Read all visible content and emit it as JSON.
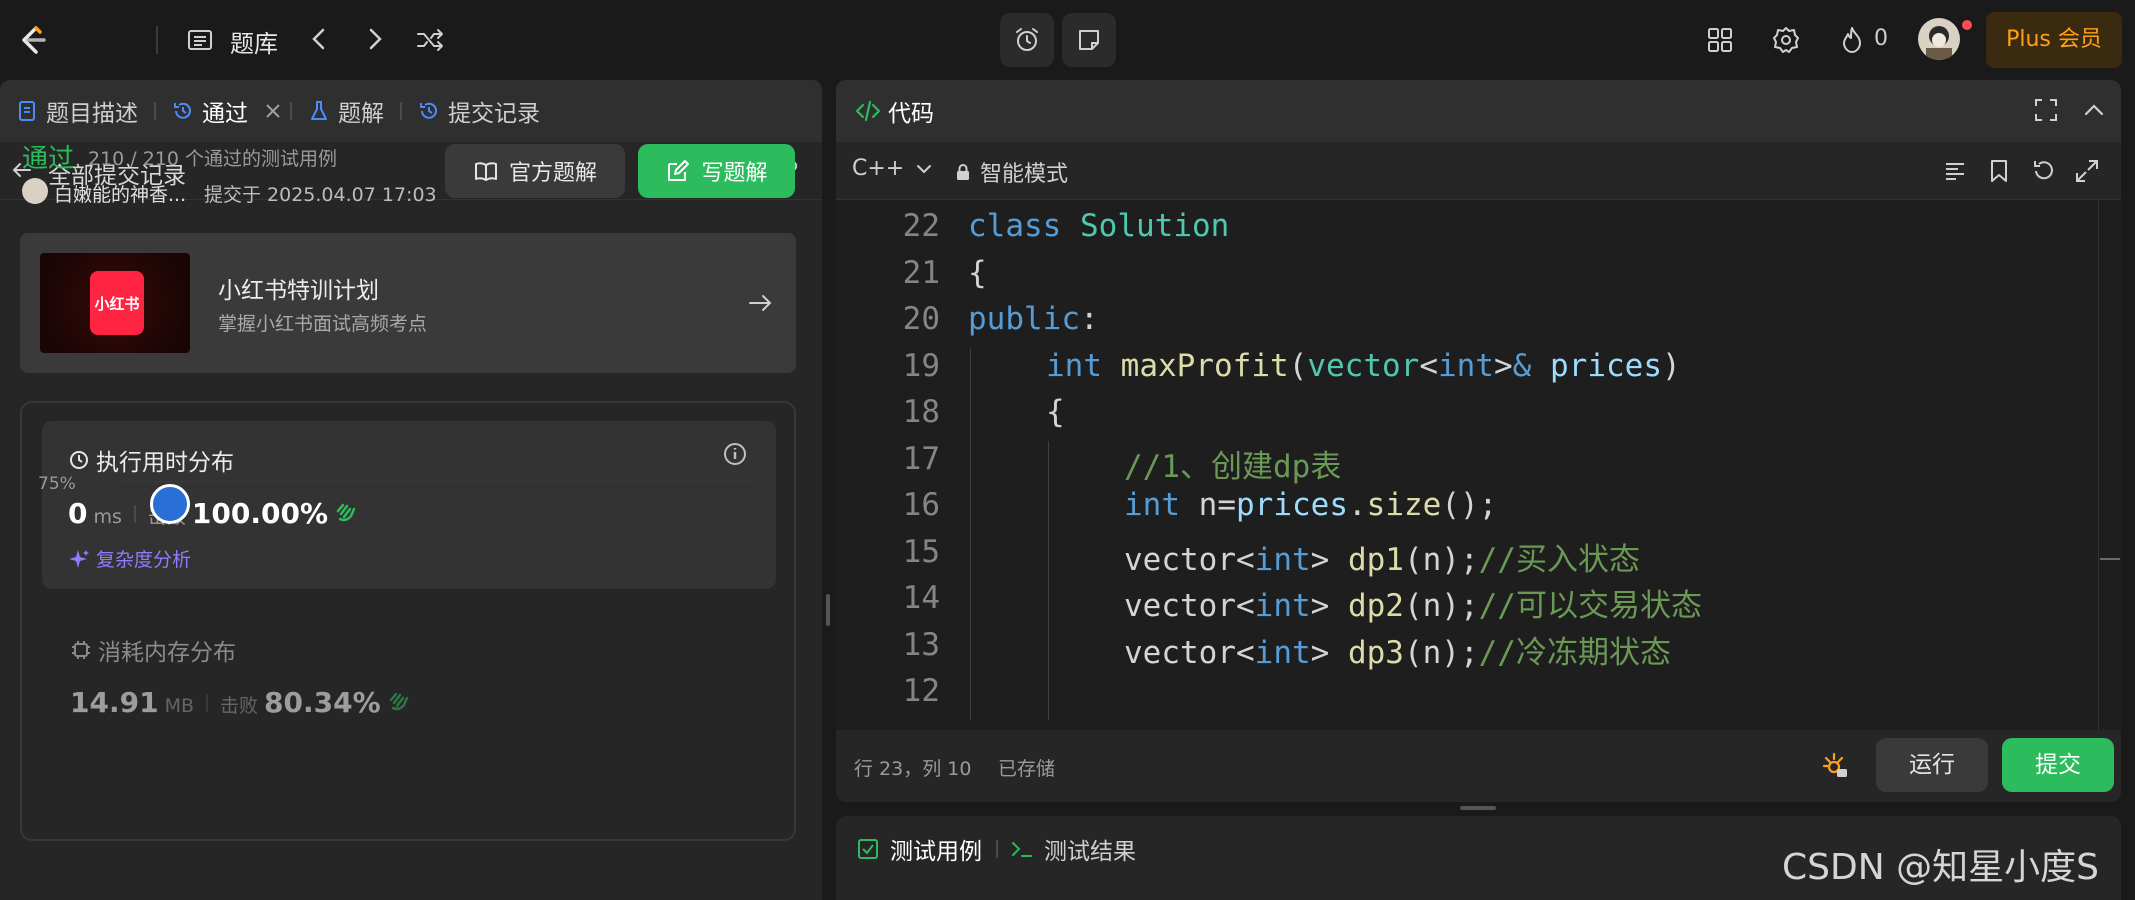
{
  "topbar": {
    "problem_bank": "题库",
    "streak": "0",
    "plus_label": "Plus 会员"
  },
  "left": {
    "tabs": [
      "题目描述",
      "通过",
      "题解",
      "提交记录"
    ],
    "sub_title": "全部提交记录",
    "status": "通过",
    "status_detail": "210 / 210 个通过的测试用例",
    "user_name": "白嫩能的神香...",
    "submit_time": "提交于 2025.04.07 17:03",
    "btn_official": "官方题解",
    "btn_write": "写题解",
    "promo": {
      "logo_text": "小红书",
      "title": "小红书特训计划",
      "subtitle": "掌握小红书面试高频考点"
    },
    "runtime": {
      "title": "执行用时分布",
      "value": "0",
      "unit": "ms",
      "beat_label": "击败",
      "beat_value": "100.00%",
      "complexity": "复杂度分析"
    },
    "memory": {
      "title": "消耗内存分布",
      "value": "14.91",
      "unit": "MB",
      "beat_label": "击败",
      "beat_value": "80.34%"
    },
    "chart_tick": "75%"
  },
  "editor": {
    "title": "代码",
    "language": "C++",
    "mode": "智能模式",
    "lines": [
      {
        "n": "22",
        "indent": 0,
        "tokens": [
          [
            "kw",
            "class"
          ],
          [
            "",
            " "
          ],
          [
            "ty",
            "Solution"
          ]
        ]
      },
      {
        "n": "21",
        "indent": 0,
        "tokens": [
          [
            "",
            "{"
          ]
        ]
      },
      {
        "n": "20",
        "indent": 0,
        "tokens": [
          [
            "kw",
            "public"
          ],
          [
            "",
            ":"
          ]
        ]
      },
      {
        "n": "19",
        "indent": 1,
        "tokens": [
          [
            "kw",
            "int"
          ],
          [
            "",
            " "
          ],
          [
            "fn",
            "maxProfit"
          ],
          [
            "",
            "("
          ],
          [
            "ty",
            "vector"
          ],
          [
            "",
            "<"
          ],
          [
            "kw",
            "int"
          ],
          [
            "",
            ">"
          ],
          [
            "kw",
            "&"
          ],
          [
            "",
            " "
          ],
          [
            "var",
            "prices"
          ],
          [
            "",
            ")"
          ]
        ]
      },
      {
        "n": "18",
        "indent": 1,
        "tokens": [
          [
            "",
            "{"
          ]
        ]
      },
      {
        "n": "17",
        "indent": 2,
        "tokens": [
          [
            "cm",
            "//1、创建dp表"
          ]
        ]
      },
      {
        "n": "16",
        "indent": 2,
        "tokens": [
          [
            "kw",
            "int"
          ],
          [
            "",
            " n="
          ],
          [
            "var",
            "prices"
          ],
          [
            "",
            "."
          ],
          [
            "fn",
            "size"
          ],
          [
            "",
            "();"
          ]
        ]
      },
      {
        "n": "15",
        "indent": 2,
        "tokens": [
          [
            "",
            "vector<"
          ],
          [
            "kw",
            "int"
          ],
          [
            "",
            "> "
          ],
          [
            "fn",
            "dp1"
          ],
          [
            "",
            "(n);"
          ],
          [
            "cm",
            "//买入状态"
          ]
        ]
      },
      {
        "n": "14",
        "indent": 2,
        "tokens": [
          [
            "",
            "vector<"
          ],
          [
            "kw",
            "int"
          ],
          [
            "",
            "> "
          ],
          [
            "fn",
            "dp2"
          ],
          [
            "",
            "(n);"
          ],
          [
            "cm",
            "//可以交易状态"
          ]
        ]
      },
      {
        "n": "13",
        "indent": 2,
        "tokens": [
          [
            "",
            "vector<"
          ],
          [
            "kw",
            "int"
          ],
          [
            "",
            "> "
          ],
          [
            "fn",
            "dp3"
          ],
          [
            "",
            "(n);"
          ],
          [
            "cm",
            "//冷冻期状态"
          ]
        ]
      },
      {
        "n": "12",
        "indent": 2,
        "tokens": []
      }
    ],
    "cursor_pos": "行 23，列 10",
    "saved": "已存储",
    "run": "运行",
    "submit": "提交"
  },
  "test": {
    "tab_cases": "测试用例",
    "tab_result": "测试结果"
  },
  "watermark": "CSDN @知星小度S",
  "colors": {
    "accent_green": "#2cbb5d",
    "plus_orange": "#ffa116",
    "complexity_purple": "#8e7bff"
  }
}
